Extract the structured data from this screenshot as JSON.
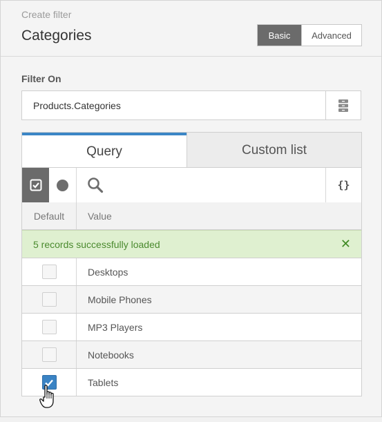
{
  "header": {
    "subtitle": "Create filter",
    "title": "Categories",
    "modes": {
      "basic": "Basic",
      "advanced": "Advanced",
      "selected": "Basic"
    }
  },
  "filter": {
    "label": "Filter On",
    "value": "Products.Categories",
    "picker_icon": "list-picker-icon"
  },
  "tabs": {
    "query": "Query",
    "custom": "Custom list",
    "active": "Query"
  },
  "toolbar": {
    "select_all_icon": "checkbox-icon",
    "toggle_icon": "dot-icon",
    "search_icon": "search-icon",
    "search_value": "",
    "braces_label": "{}"
  },
  "columns": {
    "default": "Default",
    "value": "Value"
  },
  "notice": {
    "text": "5 records successfully loaded",
    "close_icon": "close-icon"
  },
  "rows": [
    {
      "value": "Desktops",
      "checked": false
    },
    {
      "value": "Mobile Phones",
      "checked": false
    },
    {
      "value": "MP3 Players",
      "checked": false
    },
    {
      "value": "Notebooks",
      "checked": false
    },
    {
      "value": "Tablets",
      "checked": true
    }
  ],
  "colors": {
    "accent_blue": "#3b86c6",
    "dark_toggle": "#6b6b6b",
    "success_bg": "#dff0d0",
    "success_text": "#4a8a2e"
  }
}
